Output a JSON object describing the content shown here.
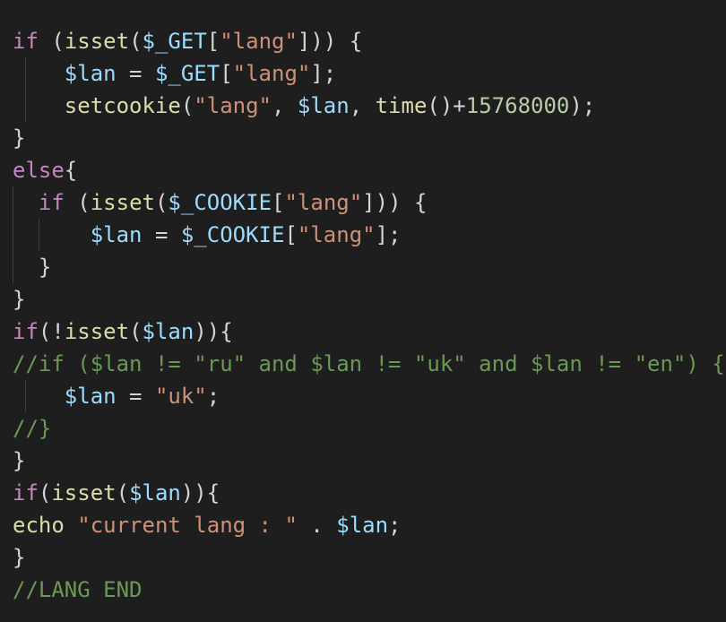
{
  "editor": {
    "theme_colors": {
      "background": "#1e1e1e",
      "keyword": "#c586c0",
      "function": "#dcdcaa",
      "variable": "#9cdcfe",
      "string": "#ce9178",
      "number": "#b5cea8",
      "comment": "#6a9955",
      "punctuation": "#d4d4d4"
    },
    "lines": [
      {
        "tokens": [
          [
            "kw",
            "if"
          ],
          [
            "pn",
            " ("
          ],
          [
            "fn",
            "isset"
          ],
          [
            "pn",
            "("
          ],
          [
            "var",
            "$_GET"
          ],
          [
            "pn",
            "["
          ],
          [
            "str",
            "\"lang\""
          ],
          [
            "pn",
            "])) {"
          ]
        ]
      },
      {
        "tokens": [
          [
            "pn",
            "    "
          ],
          [
            "var",
            "$lan"
          ],
          [
            "pn",
            " = "
          ],
          [
            "var",
            "$_GET"
          ],
          [
            "pn",
            "["
          ],
          [
            "str",
            "\"lang\""
          ],
          [
            "pn",
            "];"
          ]
        ]
      },
      {
        "tokens": [
          [
            "pn",
            "    "
          ],
          [
            "fn",
            "setcookie"
          ],
          [
            "pn",
            "("
          ],
          [
            "str",
            "\"lang\""
          ],
          [
            "pn",
            ", "
          ],
          [
            "var",
            "$lan"
          ],
          [
            "pn",
            ", "
          ],
          [
            "fn",
            "time"
          ],
          [
            "pn",
            "()+"
          ],
          [
            "num",
            "15768000"
          ],
          [
            "pn",
            ");"
          ]
        ]
      },
      {
        "tokens": [
          [
            "pn",
            "}"
          ]
        ]
      },
      {
        "tokens": [
          [
            "kw",
            "else"
          ],
          [
            "pn",
            "{"
          ]
        ]
      },
      {
        "tokens": [
          [
            "pn",
            "  "
          ],
          [
            "kw",
            "if"
          ],
          [
            "pn",
            " ("
          ],
          [
            "fn",
            "isset"
          ],
          [
            "pn",
            "("
          ],
          [
            "var",
            "$_COOKIE"
          ],
          [
            "pn",
            "["
          ],
          [
            "str",
            "\"lang\""
          ],
          [
            "pn",
            "])) {"
          ]
        ]
      },
      {
        "tokens": [
          [
            "pn",
            "      "
          ],
          [
            "var",
            "$lan"
          ],
          [
            "pn",
            " = "
          ],
          [
            "var",
            "$_COOKIE"
          ],
          [
            "pn",
            "["
          ],
          [
            "str",
            "\"lang\""
          ],
          [
            "pn",
            "];"
          ]
        ]
      },
      {
        "tokens": [
          [
            "pn",
            "  }"
          ]
        ]
      },
      {
        "tokens": [
          [
            "pn",
            "}"
          ]
        ]
      },
      {
        "tokens": [
          [
            "kw",
            "if"
          ],
          [
            "pn",
            "(!"
          ],
          [
            "fn",
            "isset"
          ],
          [
            "pn",
            "("
          ],
          [
            "var",
            "$lan"
          ],
          [
            "pn",
            ")){"
          ]
        ]
      },
      {
        "tokens": [
          [
            "cm",
            "//if ($lan != \"ru\" and $lan != \"uk\" and $lan != \"en\") {"
          ]
        ]
      },
      {
        "tokens": [
          [
            "pn",
            "    "
          ],
          [
            "var",
            "$lan"
          ],
          [
            "pn",
            " = "
          ],
          [
            "str",
            "\"uk\""
          ],
          [
            "pn",
            ";"
          ]
        ]
      },
      {
        "tokens": [
          [
            "cm",
            "//}"
          ]
        ]
      },
      {
        "tokens": [
          [
            "pn",
            "}"
          ]
        ]
      },
      {
        "tokens": [
          [
            "kw",
            "if"
          ],
          [
            "pn",
            "("
          ],
          [
            "fn",
            "isset"
          ],
          [
            "pn",
            "("
          ],
          [
            "var",
            "$lan"
          ],
          [
            "pn",
            "))"
          ],
          [
            "pn",
            "{"
          ]
        ]
      },
      {
        "tokens": [
          [
            "fn",
            "echo"
          ],
          [
            "pn",
            " "
          ],
          [
            "str",
            "\"current lang : \""
          ],
          [
            "pn",
            " . "
          ],
          [
            "var",
            "$lan"
          ],
          [
            "pn",
            ";"
          ]
        ]
      },
      {
        "tokens": [
          [
            "pn",
            "}"
          ]
        ]
      },
      {
        "tokens": [
          [
            "cm",
            "//LANG END"
          ]
        ]
      }
    ]
  }
}
